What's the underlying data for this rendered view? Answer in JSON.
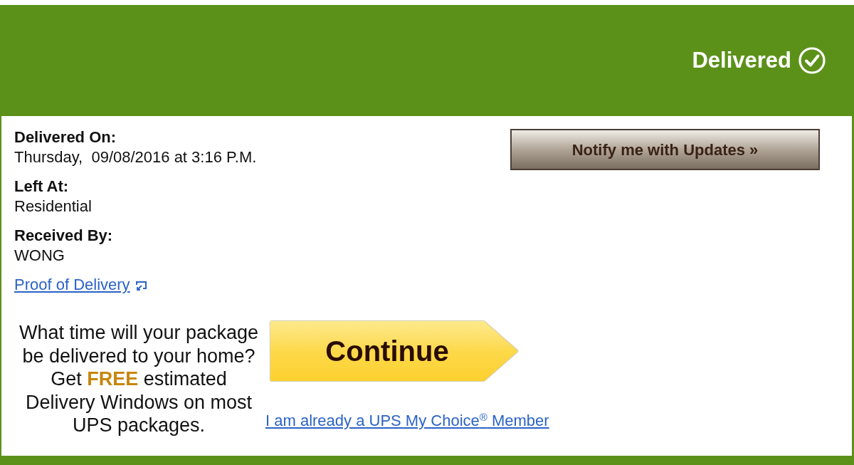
{
  "header": {
    "status": "Delivered"
  },
  "details": [
    {
      "label": "Delivered On:",
      "value": "Thursday,  09/08/2016 at 3:16 P.M."
    },
    {
      "label": "Left At:",
      "value": "Residential"
    },
    {
      "label": "Received By:",
      "value": "WONG"
    }
  ],
  "proof_link": {
    "label": "Proof of Delivery"
  },
  "notify_button": {
    "label": "Notify me with Updates »"
  },
  "promo": {
    "text": "What time will your package be delivered to your home? Get **FREE** estimated Delivery Windows on most UPS packages.",
    "button": "Continue",
    "member_link": "I am already a UPS My Choice$^{®}$ Member"
  }
}
